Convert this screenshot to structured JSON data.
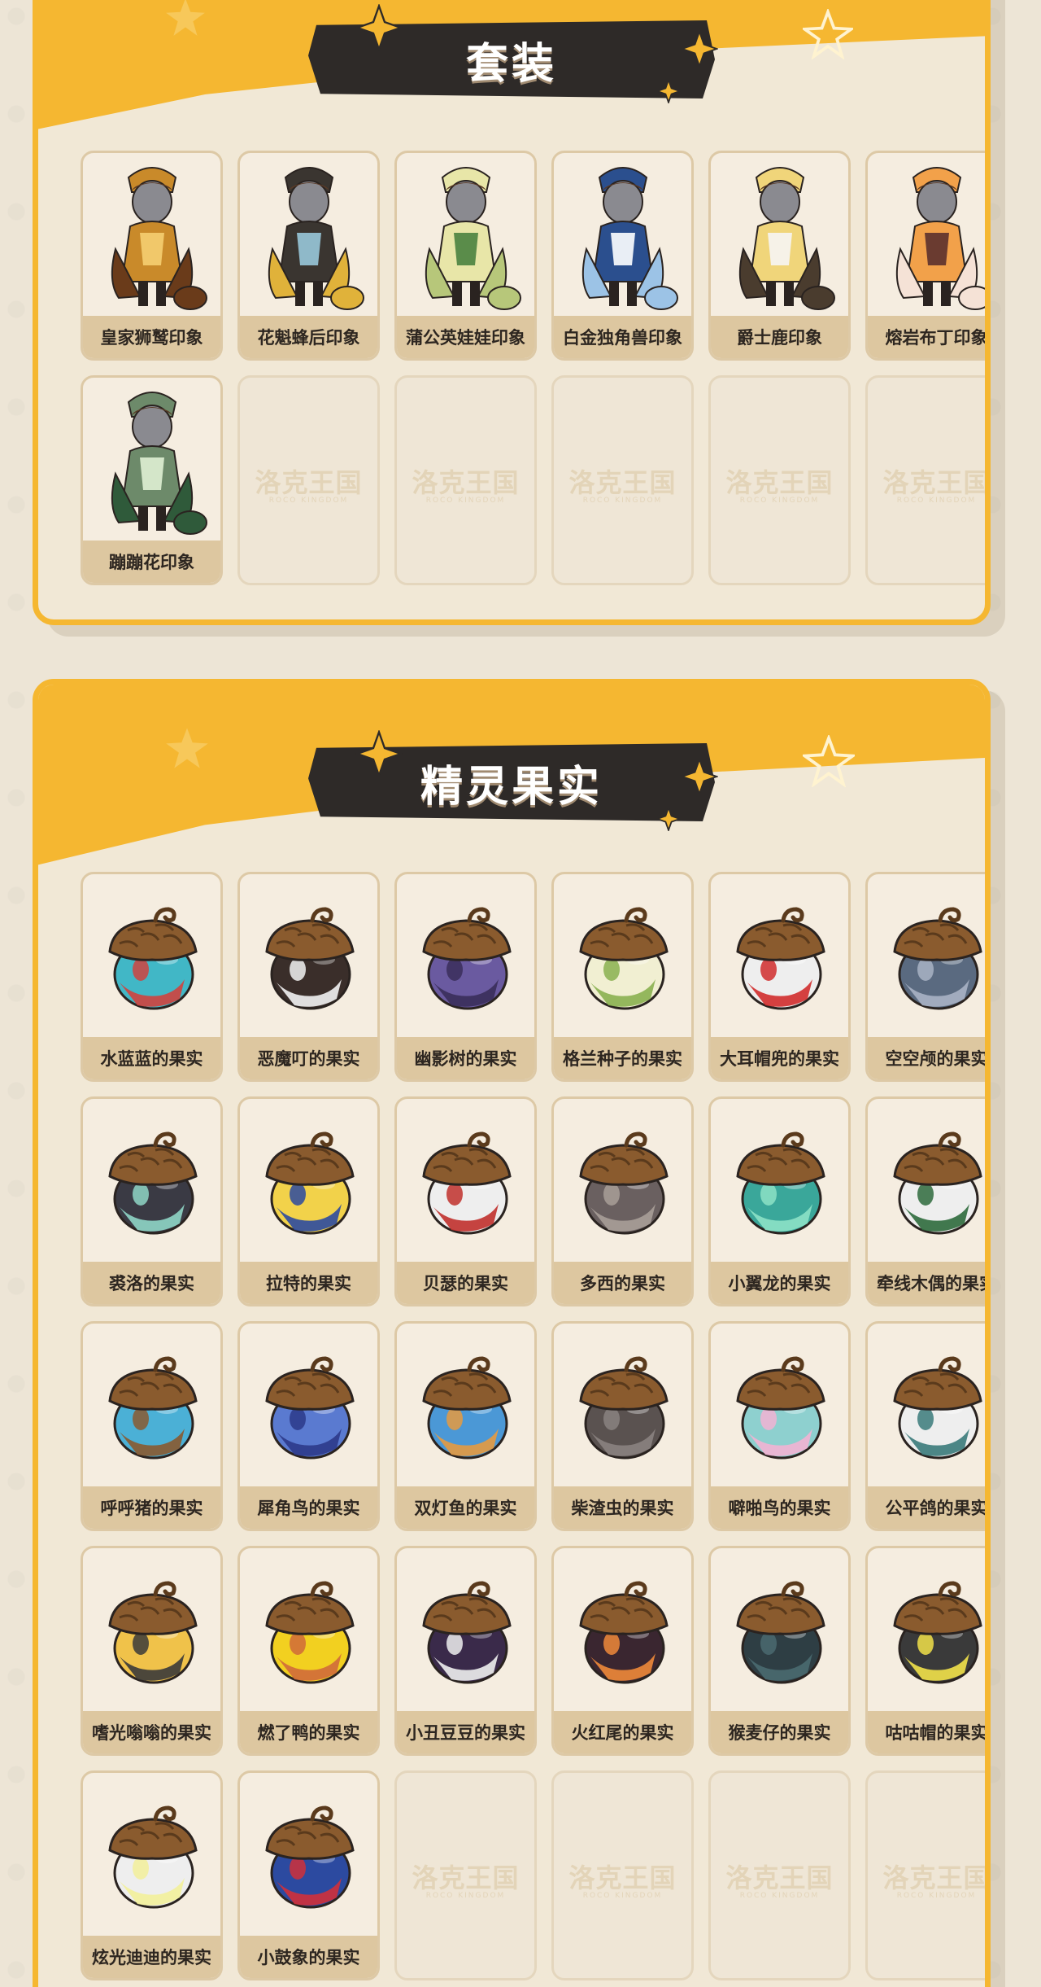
{
  "colors": {
    "panel_border": "#f5b731",
    "panel_fill": "#f1e8d6",
    "banner_bg": "#2e2a28",
    "label_bg": "#ddc7a0",
    "card_border": "#ddc9a6"
  },
  "empty_card": {
    "watermark": "洛克王国",
    "watermark_sub": "ROCO KINGDOM"
  },
  "sections": {
    "outfits": {
      "title": "套装",
      "items": [
        {
          "label": "皇家狮鹫印象",
          "colors": [
            "#c98a2a",
            "#6a3b1a",
            "#f1c86a"
          ]
        },
        {
          "label": "花魁蜂后印象",
          "colors": [
            "#3a3530",
            "#e0b23a",
            "#8fb9c9"
          ]
        },
        {
          "label": "蒲公英娃娃印象",
          "colors": [
            "#e8e6a8",
            "#b7c77a",
            "#5a8c4a"
          ]
        },
        {
          "label": "白金独角兽印象",
          "colors": [
            "#2b4f8e",
            "#9cc3e6",
            "#e9eef5"
          ]
        },
        {
          "label": "爵士鹿印象",
          "colors": [
            "#f0d57a",
            "#4a3c2e",
            "#f6f2e8"
          ]
        },
        {
          "label": "熔岩布丁印象",
          "colors": [
            "#f2a14a",
            "#f5e2d6",
            "#6a3b30"
          ]
        },
        {
          "label": "蹦蹦花印象",
          "colors": [
            "#6d8a6a",
            "#2f5a3a",
            "#d4e6c9"
          ]
        }
      ]
    },
    "fruits": {
      "title": "精灵果实",
      "items": [
        {
          "label": "水蓝蓝的果实",
          "colors": [
            "#41b7c6",
            "#d0433e"
          ]
        },
        {
          "label": "恶魔叮的果实",
          "colors": [
            "#3a2e2a",
            "#f2f2f2"
          ]
        },
        {
          "label": "幽影树的果实",
          "colors": [
            "#6a5aa0",
            "#3a2e5a"
          ]
        },
        {
          "label": "格兰种子的果实",
          "colors": [
            "#f1efd2",
            "#8ab050"
          ]
        },
        {
          "label": "大耳帽兜的果实",
          "colors": [
            "#eeeeee",
            "#d02c2c"
          ]
        },
        {
          "label": "空空颅的果实",
          "colors": [
            "#5a6a80",
            "#a9b3c4"
          ]
        },
        {
          "label": "裘洛的果实",
          "colors": [
            "#3a3a44",
            "#8fd6c6"
          ]
        },
        {
          "label": "拉特的果实",
          "colors": [
            "#f2d24a",
            "#2c4aa0"
          ]
        },
        {
          "label": "贝瑟的果实",
          "colors": [
            "#eeeeee",
            "#c0302c"
          ]
        },
        {
          "label": "多西的果实",
          "colors": [
            "#6a6060",
            "#a89f98"
          ]
        },
        {
          "label": "小翼龙的果实",
          "colors": [
            "#3aa79a",
            "#8de2c6"
          ]
        },
        {
          "label": "牵线木偶的果实",
          "colors": [
            "#eeeeee",
            "#2e6a3c"
          ]
        },
        {
          "label": "呼呼猪的果实",
          "colors": [
            "#4bb0d6",
            "#8a5a30"
          ]
        },
        {
          "label": "犀角鸟的果实",
          "colors": [
            "#5a7ad0",
            "#2c3a8a"
          ]
        },
        {
          "label": "双灯鱼的果实",
          "colors": [
            "#4b98d6",
            "#e69a40"
          ]
        },
        {
          "label": "柴渣虫的果实",
          "colors": [
            "#5a5250",
            "#8a8280"
          ]
        },
        {
          "label": "噼啪鸟的果实",
          "colors": [
            "#8ed0cf",
            "#f2b3d3"
          ]
        },
        {
          "label": "公平鸽的果实",
          "colors": [
            "#eeeeee",
            "#3a7a7a"
          ]
        },
        {
          "label": "嗜光嗡嗡的果实",
          "colors": [
            "#f0c24a",
            "#3a3a3a"
          ]
        },
        {
          "label": "燃了鸭的果实",
          "colors": [
            "#f2d020",
            "#d06a3a"
          ]
        },
        {
          "label": "小丑豆豆的果实",
          "colors": [
            "#3a2a4a",
            "#eeeeee"
          ]
        },
        {
          "label": "火红尾的果实",
          "colors": [
            "#3a2630",
            "#f08a3a"
          ]
        },
        {
          "label": "猴麦仔的果实",
          "colors": [
            "#2e3e44",
            "#4a6a70"
          ]
        },
        {
          "label": "咕咕帽的果实",
          "colors": [
            "#3a3a3a",
            "#f2e24a"
          ]
        },
        {
          "label": "炫光迪迪的果实",
          "colors": [
            "#eeeeee",
            "#f2ef9a"
          ]
        },
        {
          "label": "小鼓象的果实",
          "colors": [
            "#2c4aa0",
            "#d0303a"
          ]
        }
      ]
    }
  }
}
